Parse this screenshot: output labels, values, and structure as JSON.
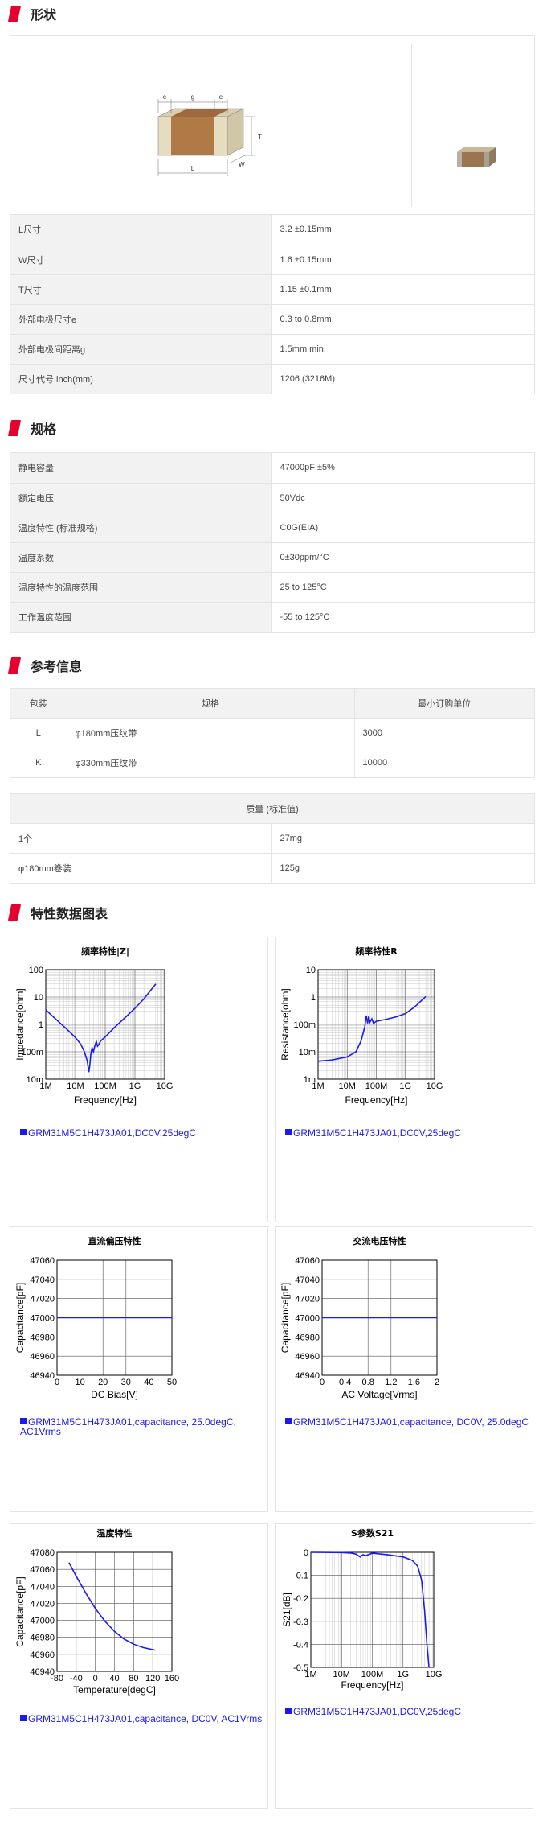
{
  "sections": {
    "shape": "形状",
    "spec": "规格",
    "ref": "参考信息",
    "charts": "特性数据图表"
  },
  "drawing": {
    "e1": "e",
    "g": "g",
    "e2": "e",
    "T": "T",
    "W": "W",
    "L": "L"
  },
  "dimensions": [
    {
      "label": "L尺寸",
      "value": "3.2 ±0.15mm"
    },
    {
      "label": "W尺寸",
      "value": "1.6 ±0.15mm"
    },
    {
      "label": "T尺寸",
      "value": "1.15 ±0.1mm"
    },
    {
      "label": "外部电极尺寸e",
      "value": "0.3 to 0.8mm"
    },
    {
      "label": "外部电极间距离g",
      "value": "1.5mm min."
    },
    {
      "label": "尺寸代号 inch(mm)",
      "value": "1206 (3216M)"
    }
  ],
  "specs": [
    {
      "label": "静电容量",
      "value": "47000pF ±5%"
    },
    {
      "label": "额定电压",
      "value": "50Vdc"
    },
    {
      "label": "温度特性 (标准规格)",
      "value": "C0G(EIA)"
    },
    {
      "label": "温度系数",
      "value": "0±30ppm/°C"
    },
    {
      "label": "温度特性的温度范围",
      "value": "25 to 125°C"
    },
    {
      "label": "工作温度范围",
      "value": "-55 to 125°C"
    }
  ],
  "packaging": {
    "headers": [
      "包装",
      "规格",
      "最小订购单位"
    ],
    "rows": [
      {
        "code": "L",
        "spec": "φ180mm压纹带",
        "moq": "3000"
      },
      {
        "code": "K",
        "spec": "φ330mm压纹带",
        "moq": "10000"
      }
    ]
  },
  "mass": {
    "header": "质量 (标准值)",
    "rows": [
      {
        "label": "1个",
        "value": "27mg"
      },
      {
        "label": "φ180mm卷装",
        "value": "125g"
      }
    ]
  },
  "colors": {
    "accent": "#e5002d",
    "curve": "#1a1af0"
  },
  "chart_data": [
    {
      "type": "line",
      "title": "频率特性|Z|",
      "xlabel": "Frequency[Hz]",
      "ylabel": "Impedance[ohm]",
      "x_scale": "log",
      "y_scale": "log",
      "xlim": [
        1000000,
        10000000000
      ],
      "ylim": [
        0.01,
        100
      ],
      "xticks": [
        "1M",
        "10M",
        "100M",
        "1G",
        "10G"
      ],
      "yticks": [
        "100",
        "10",
        "1",
        "100m",
        "10m"
      ],
      "series": [
        {
          "name": "GRM31M5C1H473JA01,DC0V,25degC",
          "x": [
            1000000,
            2000000,
            5000000,
            10000000,
            15000000,
            20000000,
            25000000,
            28000000,
            30000000,
            33000000,
            36000000,
            40000000,
            45000000,
            50000000,
            55000000,
            60000000,
            70000000,
            100000000,
            200000000,
            500000000,
            1000000000,
            2000000000,
            3000000000,
            5000000000
          ],
          "y": [
            3.4,
            1.7,
            0.68,
            0.33,
            0.19,
            0.1,
            0.045,
            0.018,
            0.03,
            0.09,
            0.14,
            0.1,
            0.17,
            0.24,
            0.16,
            0.18,
            0.25,
            0.35,
            0.75,
            1.9,
            3.9,
            8.5,
            15,
            30
          ]
        }
      ]
    },
    {
      "type": "line",
      "title": "频率特性R",
      "xlabel": "Frequency[Hz]",
      "ylabel": "Resistance[ohm]",
      "x_scale": "log",
      "y_scale": "log",
      "xlim": [
        1000000,
        10000000000
      ],
      "ylim": [
        0.001,
        10
      ],
      "xticks": [
        "1M",
        "10M",
        "100M",
        "1G",
        "10G"
      ],
      "yticks": [
        "10",
        "1",
        "100m",
        "10m",
        "1m"
      ],
      "series": [
        {
          "name": "GRM31M5C1H473JA01,DC0V,25degC",
          "x": [
            1000000,
            3000000,
            10000000,
            20000000,
            30000000,
            40000000,
            45000000,
            50000000,
            55000000,
            60000000,
            70000000,
            80000000,
            100000000,
            200000000,
            500000000,
            1000000000,
            2000000000,
            5000000000
          ],
          "y": [
            0.0045,
            0.005,
            0.0065,
            0.01,
            0.025,
            0.08,
            0.21,
            0.11,
            0.2,
            0.12,
            0.16,
            0.11,
            0.13,
            0.15,
            0.19,
            0.25,
            0.42,
            1.05
          ]
        }
      ]
    },
    {
      "type": "line",
      "title": "直流偏压特性",
      "xlabel": "DC Bias[V]",
      "ylabel": "Capacitance[pF]",
      "xlim": [
        0,
        50
      ],
      "ylim": [
        46940,
        47060
      ],
      "xticks": [
        "0",
        "10",
        "20",
        "30",
        "40",
        "50"
      ],
      "yticks": [
        "47060",
        "47040",
        "47020",
        "47000",
        "46980",
        "46960",
        "46940"
      ],
      "series": [
        {
          "name": "GRM31M5C1H473JA01,capacitance, 25.0degC, AC1Vrms",
          "x": [
            0,
            50
          ],
          "y": [
            47000,
            47000
          ]
        }
      ]
    },
    {
      "type": "line",
      "title": "交流电压特性",
      "xlabel": "AC Voltage[Vrms]",
      "ylabel": "Capacitance[pF]",
      "xlim": [
        0,
        2
      ],
      "ylim": [
        46940,
        47060
      ],
      "xticks": [
        "0",
        "0.4",
        "0.8",
        "1.2",
        "1.6",
        "2"
      ],
      "yticks": [
        "47060",
        "47040",
        "47020",
        "47000",
        "46980",
        "46960",
        "46940"
      ],
      "series": [
        {
          "name": "GRM31M5C1H473JA01,capacitance, DC0V, 25.0degC",
          "x": [
            0,
            2
          ],
          "y": [
            47000,
            47000
          ]
        }
      ]
    },
    {
      "type": "line",
      "title": "温度特性",
      "xlabel": "Temperature[degC]",
      "ylabel": "Capacitance[pF]",
      "xlim": [
        -80,
        160
      ],
      "ylim": [
        46940,
        47080
      ],
      "xticks": [
        "-80",
        "-40",
        "0",
        "40",
        "80",
        "120",
        "160"
      ],
      "yticks": [
        "47080",
        "47060",
        "47040",
        "47020",
        "47000",
        "46980",
        "46960",
        "46940"
      ],
      "series": [
        {
          "name": "GRM31M5C1H473JA01,capacitance, DC0V, AC1Vrms",
          "x": [
            -55,
            -40,
            -20,
            0,
            20,
            40,
            60,
            80,
            100,
            125
          ],
          "y": [
            47068,
            47052,
            47032,
            47014,
            46999,
            46987,
            46978,
            46972,
            46968,
            46965
          ]
        }
      ]
    },
    {
      "type": "line",
      "title": "S参数S21",
      "xlabel": "Frequency[Hz]",
      "ylabel": "S21[dB]",
      "x_scale": "log",
      "xlim": [
        1000000,
        10000000000
      ],
      "ylim": [
        -0.5,
        0
      ],
      "xticks": [
        "1M",
        "10M",
        "100M",
        "1G",
        "10G"
      ],
      "yticks": [
        "0",
        "-0.1",
        "-0.2",
        "-0.3",
        "-0.4",
        "-0.5"
      ],
      "series": [
        {
          "name": "GRM31M5C1H473JA01,DC0V,25degC",
          "x": [
            1000000,
            10000000,
            20000000,
            30000000,
            40000000,
            50000000,
            60000000,
            100000000,
            300000000,
            1000000000,
            2000000000,
            3000000000,
            4000000000,
            5000000000,
            6000000000,
            7000000000
          ],
          "y": [
            0,
            -0.001,
            -0.003,
            -0.008,
            -0.02,
            -0.01,
            -0.015,
            -0.004,
            -0.01,
            -0.02,
            -0.035,
            -0.06,
            -0.12,
            -0.25,
            -0.4,
            -0.5
          ]
        }
      ]
    }
  ]
}
